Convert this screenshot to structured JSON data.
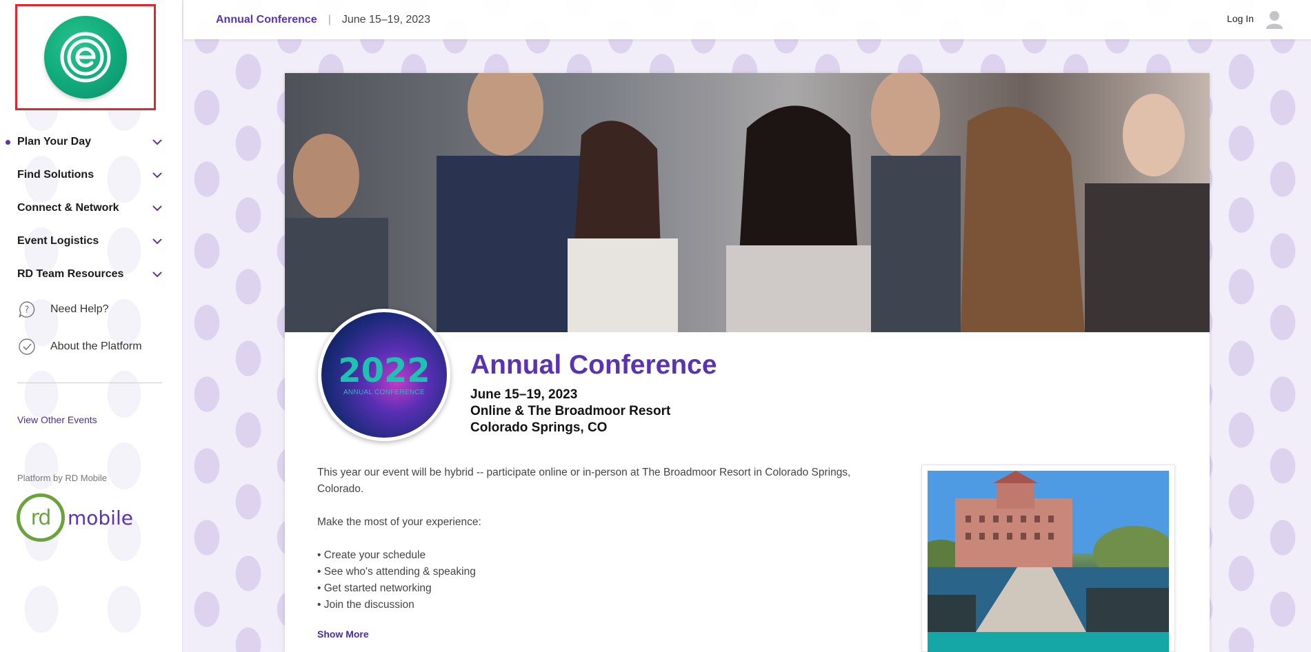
{
  "topbar": {
    "event_name": "Annual Conference",
    "separator": "|",
    "dates": "June 15–19, 2023",
    "login_label": "Log In"
  },
  "sidebar": {
    "nav": [
      {
        "label": "Plan Your Day",
        "active": true
      },
      {
        "label": "Find Solutions",
        "active": false
      },
      {
        "label": "Connect & Network",
        "active": false
      },
      {
        "label": "Event Logistics",
        "active": false
      },
      {
        "label": "RD Team Resources",
        "active": false
      }
    ],
    "help_label": "Need Help?",
    "about_label": "About the Platform",
    "other_events_label": "View Other Events",
    "platform_by": "Platform by RD Mobile",
    "rd_logo_left": "rd",
    "rd_logo_right": "mobile"
  },
  "event": {
    "logo_year": "2022",
    "logo_sub": "ANNUAL CONFERENCE",
    "title": "Annual Conference",
    "dates": "June 15–19, 2023",
    "venue": "Online & The Broadmoor Resort",
    "location": "Colorado Springs, CO"
  },
  "description": {
    "intro": "This year our event will be hybrid -- participate online or in-person at The Broadmoor Resort in Colorado Springs, Colorado.",
    "lead": "Make the most of your experience:",
    "bullets": [
      "Create your schedule",
      "See who's attending & speaking",
      "Get started networking",
      "Join the discussion"
    ],
    "show_more": "Show More"
  },
  "colors": {
    "brand_purple": "#5b33b0",
    "logo_green": "#10a97a",
    "rd_green": "#6aa33a",
    "teal": "#14a7a6",
    "highlight_red": "#e0262b"
  }
}
